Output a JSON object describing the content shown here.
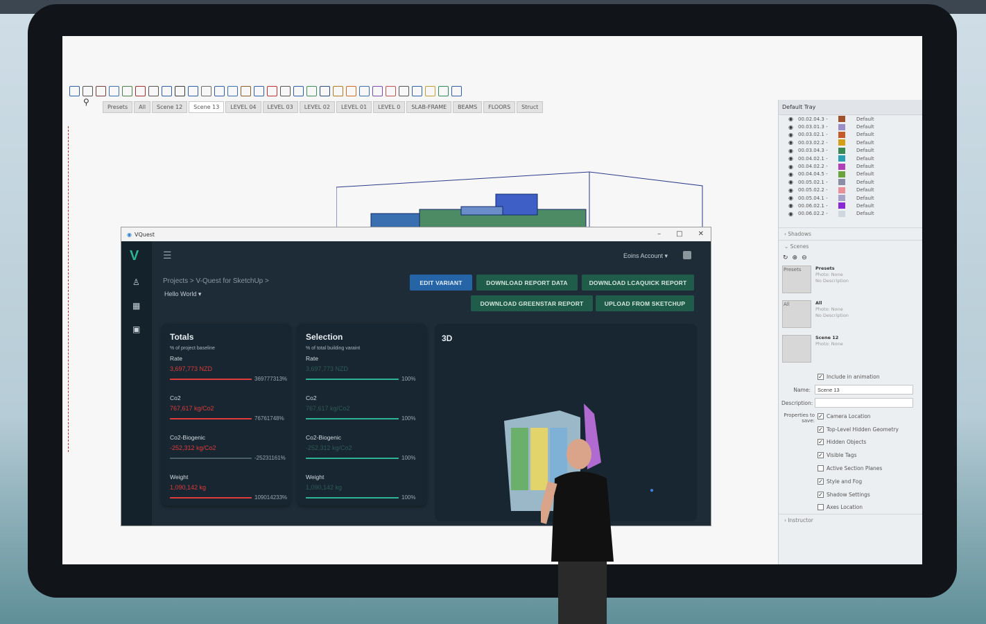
{
  "sketchup": {
    "scene_tabs": [
      "Presets",
      "All",
      "Scene 12",
      "Scene 13",
      "LEVEL 04",
      "LEVEL 03",
      "LEVEL 02",
      "LEVEL 01",
      "LEVEL 0",
      "SLAB-FRAME",
      "BEAMS",
      "FLOORS",
      "Struct"
    ],
    "active_tab": "Scene 13",
    "tray": {
      "title": "Default Tray",
      "tags": [
        {
          "name": "00.02.04.3 -",
          "value": "Default",
          "color": "#a0522d"
        },
        {
          "name": "00.03.01.3 -",
          "value": "Default",
          "color": "#9c8fc7"
        },
        {
          "name": "00.03.02.1 -",
          "value": "Default",
          "color": "#c45a2a"
        },
        {
          "name": "00.03.02.2 -",
          "value": "Default",
          "color": "#d4a018"
        },
        {
          "name": "00.03.04.3 -",
          "value": "Default",
          "color": "#3b8a55"
        },
        {
          "name": "00.04.02.1 -",
          "value": "Default",
          "color": "#29a0b1"
        },
        {
          "name": "00.04.02.2 -",
          "value": "Default",
          "color": "#b23fb8"
        },
        {
          "name": "00.04.04.5 -",
          "value": "Default",
          "color": "#6aa23c"
        },
        {
          "name": "00.05.02.1 -",
          "value": "Default",
          "color": "#8b8fa6"
        },
        {
          "name": "00.05.02.2 -",
          "value": "Default",
          "color": "#e9909a"
        },
        {
          "name": "00.05.04.1 -",
          "value": "Default",
          "color": "#a8a3c9"
        },
        {
          "name": "00.06.02.1 -",
          "value": "Default",
          "color": "#8a28d6"
        },
        {
          "name": "00.06.02.2 -",
          "value": "Default",
          "color": "#cfd6de"
        }
      ],
      "shadows_label": "Shadows",
      "scenes_label": "Scenes",
      "scenes": [
        {
          "thumb": "Presets",
          "title": "Presets",
          "photo": "Photo: None",
          "desc": "No Description"
        },
        {
          "thumb": "All",
          "title": "All",
          "photo": "Photo: None",
          "desc": "No Description"
        },
        {
          "thumb": "",
          "title": "Scene 12",
          "photo": "Photo: None",
          "desc": ""
        }
      ],
      "include_in_animation": "Include in animation",
      "name_label": "Name:",
      "name_value": "Scene 13",
      "description_label": "Description:",
      "properties_label": "Properties to save:",
      "properties": [
        {
          "label": "Camera Location",
          "checked": true
        },
        {
          "label": "Top-Level Hidden Geometry",
          "checked": true
        },
        {
          "label": "Hidden Objects",
          "checked": true
        },
        {
          "label": "Visible Tags",
          "checked": true
        },
        {
          "label": "Active Section Planes",
          "checked": false
        },
        {
          "label": "Style and Fog",
          "checked": true
        },
        {
          "label": "Shadow Settings",
          "checked": true
        },
        {
          "label": "Axes Location",
          "checked": false
        }
      ],
      "instructor_label": "Instructor"
    }
  },
  "vquest": {
    "window_title": "VQuest",
    "account": "Eoins Account ▾",
    "breadcrumb": "Projects  >  V-Quest for SketchUp  >",
    "variant": "Hello World ▾",
    "buttons": {
      "edit_variant": "EDIT VARIANT",
      "download_report_data": "DOWNLOAD REPORT DATA",
      "download_lcaquick": "DOWNLOAD LCAQUICK REPORT",
      "download_greenstar": "DOWNLOAD GREENSTAR REPORT",
      "upload_sketchup": "UPLOAD FROM SKETCHUP"
    },
    "totals": {
      "title": "Totals",
      "subtitle": "% of project baseline",
      "metrics": [
        {
          "label": "Rate",
          "value": "3,697,773 NZD",
          "pct": "369777313%",
          "fill": 1.0
        },
        {
          "label": "Co2",
          "value": "767,617 kg/Co2",
          "pct": "76761748%",
          "fill": 1.0
        },
        {
          "label": "Co2-Biogenic",
          "value": "-252,312 kg/Co2",
          "pct": "-25231161%",
          "fill": 0.0
        },
        {
          "label": "Weight",
          "value": "1,090,142 kg",
          "pct": "109014233%",
          "fill": 1.0
        }
      ]
    },
    "selection": {
      "title": "Selection",
      "subtitle": "% of total building varaint",
      "metrics": [
        {
          "label": "Rate",
          "value": "3,697,773 NZD",
          "pct": "100%",
          "fill": 1.0
        },
        {
          "label": "Co2",
          "value": "767,617 kg/Co2",
          "pct": "100%",
          "fill": 1.0
        },
        {
          "label": "Co2-Biogenic",
          "value": "-252,312 kg/Co2",
          "pct": "100%",
          "fill": 1.0
        },
        {
          "label": "Weight",
          "value": "1,090,142 kg",
          "pct": "100%",
          "fill": 1.0
        }
      ]
    },
    "viewer_title": "3D",
    "colors": {
      "accent": "#2db395",
      "danger": "#e03a3a",
      "primary_button": "#2564a6",
      "secondary_button": "#1f5c4a"
    }
  }
}
